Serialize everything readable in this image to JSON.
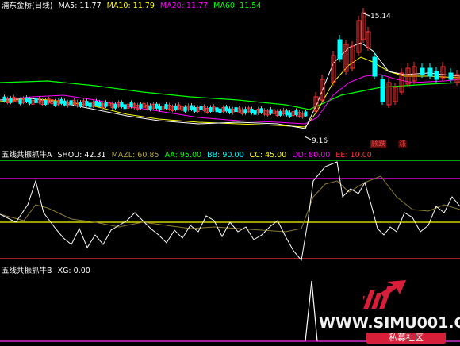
{
  "main": {
    "title": "浦东金桥(日线)",
    "ma": [
      {
        "label": "MA5: 11.77",
        "color": "#ffffff"
      },
      {
        "label": "MA10: 11.79",
        "color": "#ffff00"
      },
      {
        "label": "MA20: 11.77",
        "color": "#ff00ff"
      },
      {
        "label": "MA60: 11.54",
        "color": "#00ff00"
      }
    ],
    "high_label": "15.14",
    "low_label": "9.16",
    "tags": [
      {
        "text": "顾跌",
        "color": "#ff3333",
        "bg": "#5a1010"
      },
      {
        "text": "涨",
        "color": "#ff3333",
        "bg": "#3a0505"
      }
    ]
  },
  "indicator_a": {
    "title": "五线共振抓牛A",
    "items": [
      {
        "label": "SHOU: 42.31",
        "color": "#ffffff"
      },
      {
        "label": "MAZL: 60.85",
        "color": "#b5a642"
      },
      {
        "label": "AA: 95.00",
        "color": "#00ff00"
      },
      {
        "label": "BB: 90.00",
        "color": "#00ffff"
      },
      {
        "label": "CC: 45.00",
        "color": "#ffff00"
      },
      {
        "label": "DD: 80.00",
        "color": "#ff00ff"
      },
      {
        "label": "EE: 10.00",
        "color": "#ff3333"
      }
    ]
  },
  "indicator_b": {
    "title": "五线共振抓牛B",
    "items": [
      {
        "label": "XG: 0.00",
        "color": "#ffffff"
      }
    ]
  },
  "watermark": {
    "text": "WWW.SIMU001.CN",
    "sub": "私募社区"
  }
}
